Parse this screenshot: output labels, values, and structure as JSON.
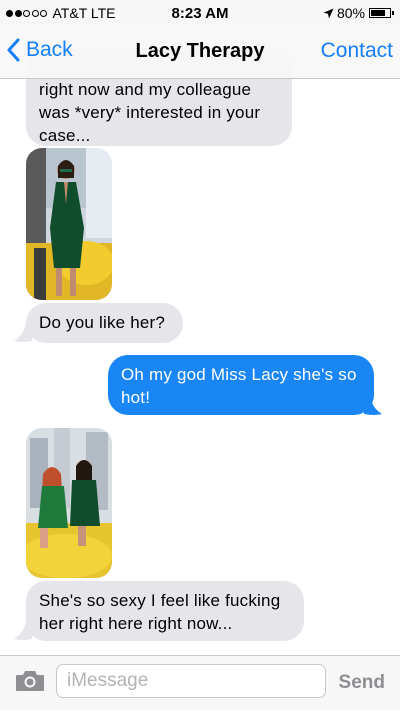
{
  "status_bar": {
    "carrier": "AT&T LTE",
    "time": "8:23 AM",
    "battery": "80%",
    "battery_level": 0.8,
    "signal_bars_filled": 2,
    "signal_bars_total": 5
  },
  "nav": {
    "back_label": "Back",
    "title": "Lacy Therapy",
    "contact_label": "Contact"
  },
  "messages": [
    {
      "sender": "them",
      "type": "text",
      "text": "right now and my colleague was *very* interested in your case...",
      "partial_top_text": "(cut off)"
    },
    {
      "sender": "them",
      "type": "image",
      "icon": "photo-woman-green-dress"
    },
    {
      "sender": "them",
      "type": "text",
      "text": "Do you like her?"
    },
    {
      "sender": "me",
      "type": "text",
      "text": "Oh my god Miss Lacy she's so hot!"
    },
    {
      "sender": "them",
      "type": "image",
      "icon": "photo-two-women"
    },
    {
      "sender": "them",
      "type": "text",
      "text": "She's so sexy I feel like fucking her right here right now..."
    }
  ],
  "composer": {
    "placeholder": "iMessage",
    "value": "",
    "send_label": "Send"
  },
  "colors": {
    "accent": "#157efb",
    "sent_bubble": "#1a86f5",
    "received_bubble": "#e5e5ea"
  }
}
